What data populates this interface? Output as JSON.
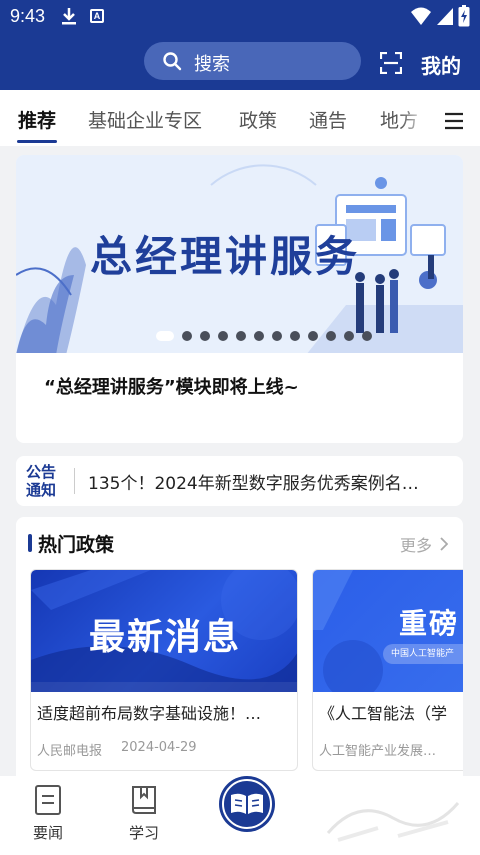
{
  "status_bar": {
    "time": "9:43",
    "icons": [
      "download-icon",
      "a-notification-icon",
      "wifi-icon",
      "signal-icon",
      "battery-icon"
    ]
  },
  "header": {
    "search_placeholder": "搜索",
    "mine_label": "我的"
  },
  "tabs": [
    {
      "label": "推荐",
      "active": true
    },
    {
      "label": "基础企业专区",
      "active": false
    },
    {
      "label": "政策",
      "active": false
    },
    {
      "label": "通告",
      "active": false
    },
    {
      "label": "地方",
      "active": false
    }
  ],
  "banner": {
    "title": "总经理讲服务",
    "caption": "“总经理讲服务”模块即将上线~",
    "slide_count": 12,
    "active_slide": 1
  },
  "notice": {
    "badge_line1": "公告",
    "badge_line2": "通知",
    "text": "135个！2024年新型数字服务优秀案例名…"
  },
  "hot_policy": {
    "title": "热门政策",
    "more_label": "更多",
    "cards": [
      {
        "image_title": "最新消息",
        "title": "适度超前布局数字基础设施！…",
        "source": "人民邮电报",
        "date": "2024-04-29"
      },
      {
        "image_title": "重磅",
        "image_pill": "中国人工智能产",
        "title": "《人工智能法（学",
        "source": "人工智能产业发展…",
        "date": ""
      }
    ]
  },
  "bottom_nav": [
    {
      "label": "要闻",
      "icon": "news-icon"
    },
    {
      "label": "学习",
      "icon": "book-icon"
    },
    {
      "label": "",
      "icon": "open-book-icon"
    }
  ],
  "colors": {
    "primary": "#1b3a94",
    "search_bg": "#4967b8",
    "page_bg": "#f1f2f4"
  }
}
